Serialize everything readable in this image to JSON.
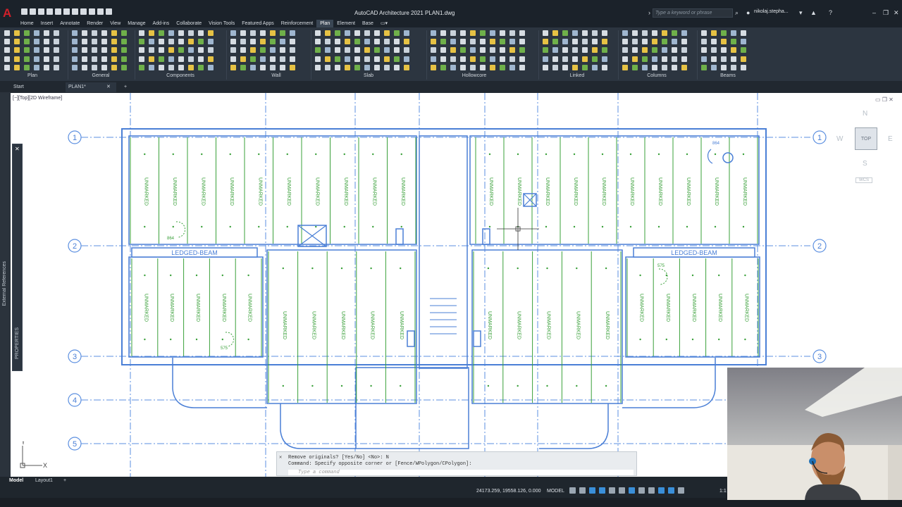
{
  "app": {
    "title": "AutoCAD Architecture 2021   PLAN1.dwg",
    "logo_letter": "A"
  },
  "search": {
    "placeholder": "Type a keyword or phrase"
  },
  "user": {
    "name": "nikolaj.stepha..."
  },
  "menu": [
    "Home",
    "Insert",
    "Annotate",
    "Render",
    "View",
    "Manage",
    "Add-ins",
    "Collaborate",
    "Vision Tools",
    "Featured Apps",
    "Reinforcement",
    "Plan",
    "Element",
    "Base"
  ],
  "menu_active": "Plan",
  "ribbon_groups": [
    "Plan",
    "General",
    "Components",
    "Wall",
    "Slab",
    "Hollowcore",
    "Linked",
    "Columns",
    "Beams"
  ],
  "file_tabs": [
    "Start",
    "PLAN1*"
  ],
  "viewport": {
    "label": "[−][Top][2D Wireframe]"
  },
  "viewcube": {
    "face": "TOP",
    "n": "N",
    "s": "S",
    "e": "E",
    "w": "W",
    "ucs": "WCS"
  },
  "palettes": {
    "xref": "External References",
    "props": "PROPERTIES"
  },
  "drawing": {
    "grid_rows": [
      "1",
      "2",
      "3",
      "4",
      "5"
    ],
    "beam_label": "LEDGED-BEAM",
    "slab_label": "UNMARKED",
    "dims": [
      "864",
      "575"
    ]
  },
  "ucs_axes": {
    "x": "X",
    "y": "Y"
  },
  "command": {
    "line1": "Remove originals? [Yes/No] <No>: N",
    "line2": "Command: Specify opposite corner or [Fence/WPolygon/CPolygon]:",
    "placeholder": "Type a command"
  },
  "layout_tabs": [
    "Model",
    "Layout1"
  ],
  "status": {
    "coords": "24173.259, 19558.126, 0.000",
    "mode": "MODEL",
    "scale": "1:1"
  },
  "colors": {
    "accent": "#3a8fd9",
    "drawing_blue": "#4a7fd6",
    "slab_green": "#3aa03a"
  }
}
